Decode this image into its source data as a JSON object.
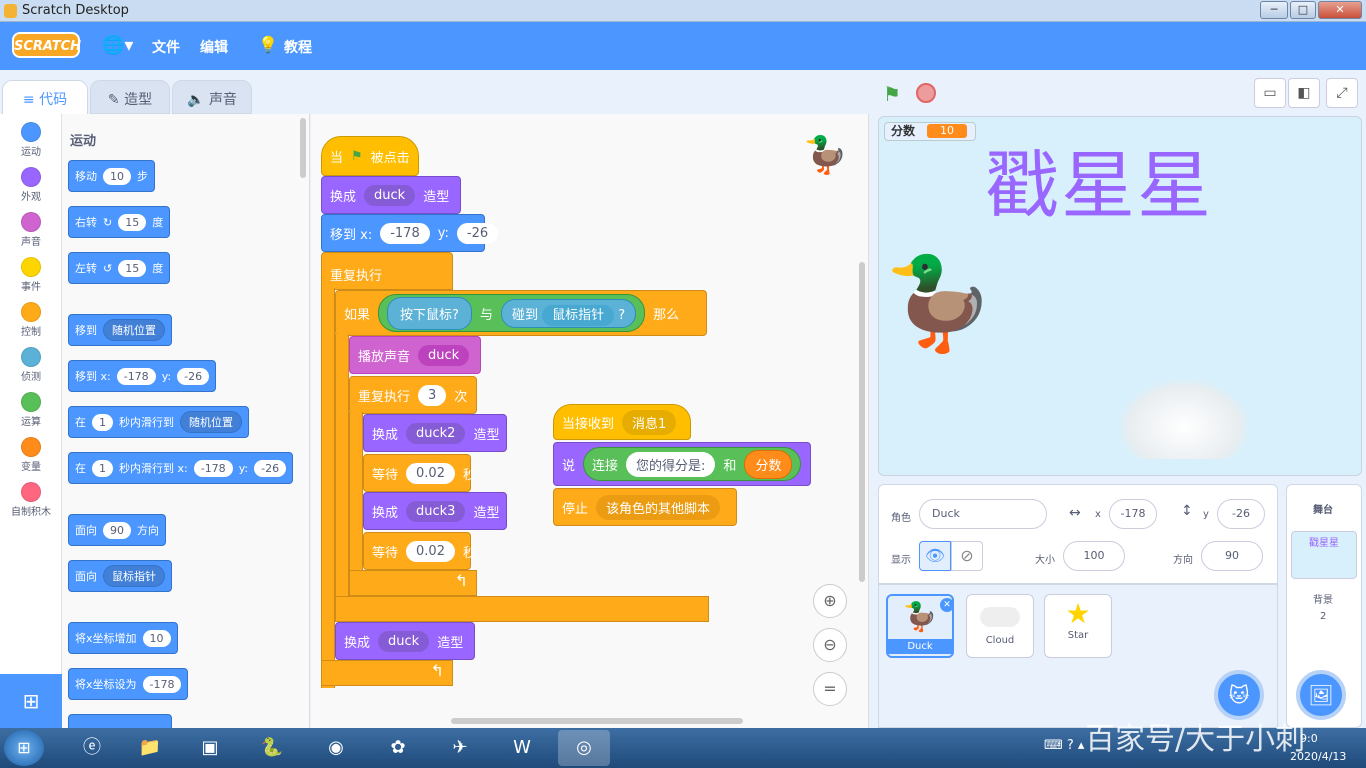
{
  "window": {
    "title": "Scratch Desktop",
    "min": "─",
    "max": "□",
    "close": "✕"
  },
  "menubar": {
    "logo": "SCRATCH",
    "file": "文件",
    "edit": "编辑",
    "tutorials": "教程"
  },
  "tabs": {
    "code": "代码",
    "costumes": "造型",
    "sounds": "声音"
  },
  "categories": [
    {
      "label": "运动",
      "color": "#4c97ff"
    },
    {
      "label": "外观",
      "color": "#9966ff"
    },
    {
      "label": "声音",
      "color": "#cf63cf"
    },
    {
      "label": "事件",
      "color": "#ffd500"
    },
    {
      "label": "控制",
      "color": "#ffab19"
    },
    {
      "label": "侦测",
      "color": "#5cb1d6"
    },
    {
      "label": "运算",
      "color": "#59c059"
    },
    {
      "label": "变量",
      "color": "#ff8c1a"
    },
    {
      "label": "自制积木",
      "color": "#ff6680"
    }
  ],
  "palette": {
    "heading": "运动",
    "move": {
      "a": "移动",
      "v": "10",
      "b": "步"
    },
    "turn_right": {
      "a": "右转",
      "v": "15",
      "b": "度"
    },
    "turn_left": {
      "a": "左转",
      "v": "15",
      "b": "度"
    },
    "goto": {
      "a": "移到",
      "dd": "随机位置"
    },
    "goto_xy": {
      "a": "移到 x:",
      "x": "-178",
      "b": "y:",
      "y": "-26"
    },
    "glide": {
      "a": "在",
      "v": "1",
      "b": "秒内滑行到",
      "dd": "随机位置"
    },
    "glide_xy": {
      "a": "在",
      "v": "1",
      "b": "秒内滑行到 x:",
      "x": "-178",
      "c": "y:",
      "y": "-26"
    },
    "point": {
      "a": "面向",
      "v": "90",
      "b": "方向"
    },
    "point_towards": {
      "a": "面向",
      "dd": "鼠标指针"
    },
    "change_x": {
      "a": "将x坐标增加",
      "v": "10"
    },
    "set_x": {
      "a": "将x坐标设为",
      "v": "-178"
    }
  },
  "script1": {
    "hat": {
      "a": "当",
      "b": "被点击"
    },
    "costume1": {
      "a": "换成",
      "dd": "duck",
      "b": "造型"
    },
    "goto": {
      "a": "移到 x:",
      "x": "-178",
      "b": "y:",
      "y": "-26"
    },
    "forever": "重复执行",
    "if": {
      "a": "如果",
      "cond1": "按下鼠标?",
      "and": "与",
      "touch": "碰到",
      "dd": "鼠标指针",
      "q": "?",
      "then": "那么"
    },
    "play": {
      "a": "播放声音",
      "dd": "duck"
    },
    "repeat": {
      "a": "重复执行",
      "v": "3",
      "b": "次"
    },
    "costume2": {
      "a": "换成",
      "dd": "duck2",
      "b": "造型"
    },
    "wait1": {
      "a": "等待",
      "v": "0.02",
      "b": "秒"
    },
    "costume3": {
      "a": "换成",
      "dd": "duck3",
      "b": "造型"
    },
    "wait2": {
      "a": "等待",
      "v": "0.02",
      "b": "秒"
    },
    "costume4": {
      "a": "换成",
      "dd": "duck",
      "b": "造型"
    }
  },
  "script2": {
    "hat": {
      "a": "当接收到",
      "dd": "消息1"
    },
    "say": {
      "a": "说",
      "join": "连接",
      "text": "您的得分是:",
      "and": "和",
      "var": "分数"
    },
    "stop": {
      "a": "停止",
      "dd": "该角色的其他脚本"
    }
  },
  "stage": {
    "monitor_label": "分数",
    "monitor_value": "10",
    "title": "戳星星"
  },
  "sprite_info": {
    "sprite_label": "角色",
    "name": "Duck",
    "x_label": "x",
    "x": "-178",
    "y_label": "y",
    "y": "-26",
    "show_label": "显示",
    "size_label": "大小",
    "size": "100",
    "dir_label": "方向",
    "dir": "90"
  },
  "sprites": [
    {
      "name": "Duck"
    },
    {
      "name": "Cloud"
    },
    {
      "name": "Star"
    }
  ],
  "stage_pane": {
    "label": "舞台",
    "backdrop_name": "戳星星",
    "backdrops_label": "背景",
    "backdrops_count": "2"
  },
  "taskbar": {
    "time": "9:0",
    "date": "2020/4/13"
  },
  "watermark": "百家号/大于小刺"
}
